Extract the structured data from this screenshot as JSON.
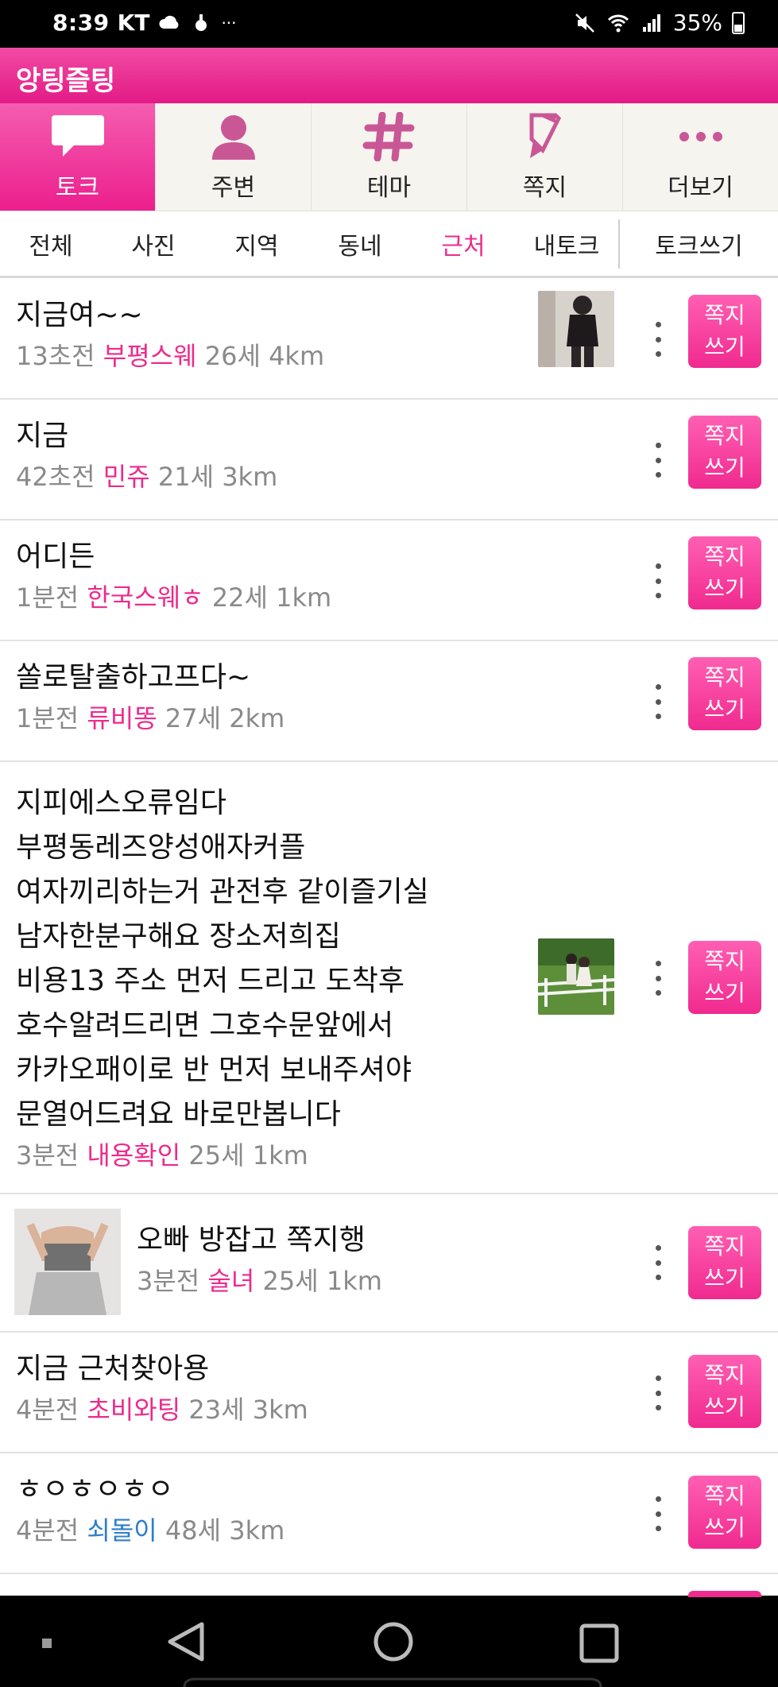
{
  "status_bar": {
    "time": "8:39",
    "carrier": "KT",
    "battery": "35%"
  },
  "app": {
    "title": "앙팅즐팅"
  },
  "main_tabs": [
    {
      "label": "토크",
      "icon": "chat-bubble-icon",
      "active": true
    },
    {
      "label": "주변",
      "icon": "person-icon",
      "active": false
    },
    {
      "label": "테마",
      "icon": "hashtag-icon",
      "active": false
    },
    {
      "label": "쪽지",
      "icon": "note-icon",
      "active": false
    },
    {
      "label": "더보기",
      "icon": "more-dots-icon",
      "active": false
    }
  ],
  "sub_tabs": [
    "전체",
    "사진",
    "지역",
    "동네",
    "근처",
    "내토크"
  ],
  "sub_tabs_active": "근처",
  "write_talk_label": "토크쓰기",
  "feed": [
    {
      "title": "지금여~~",
      "time": "13초전",
      "nick": "부평스웨",
      "age": "26세",
      "dist": "4km",
      "button": "쪽지\n쓰기"
    },
    {
      "title": "지금",
      "time": "42초전",
      "nick": "민쥬",
      "age": "21세",
      "dist": "3km",
      "button": "쪽지\n쓰기"
    },
    {
      "title": "어디든",
      "time": "1분전",
      "nick": "한국스웨ㅎ",
      "age": "22세",
      "dist": "1km",
      "button": "쪽지\n쓰기"
    },
    {
      "title": "쏠로탈출하고프다~",
      "time": "1분전",
      "nick": "류비똥",
      "age": "27세",
      "dist": "2km",
      "button": "쪽지\n쓰기"
    },
    {
      "title_lines": [
        "지피에스오류임다",
        "부평동레즈양성애자커플",
        "여자끼리하는거 관전후  같이즐기실",
        "남자한분구해요 장소저희집",
        "비용13 주소 먼저 드리고 도착후",
        "호수알려드리면 그호수문앞에서",
        "카카오패이로 반 먼저 보내주셔야",
        "문열어드려요 바로만봅니다"
      ],
      "time": "3분전",
      "nick": "내용확인",
      "age": "25세",
      "dist": "1km",
      "button": "쪽지\n쓰기"
    },
    {
      "title": "오빠 방잡고 쪽지행",
      "time": "3분전",
      "nick": "술녀",
      "age": "25세",
      "dist": "1km",
      "button": "쪽지\n쓰기"
    },
    {
      "title": "지금 근처찾아용",
      "time": "4분전",
      "nick": "초비와팅",
      "age": "23세",
      "dist": "3km",
      "button": "쪽지\n쓰기"
    },
    {
      "title": "ㅎㅇㅎㅇㅎㅇ",
      "time": "4분전",
      "nick": "쇠돌이",
      "age": "48세",
      "dist": "3km",
      "button": "쪽지\n쓰기"
    }
  ],
  "colors": {
    "accent": "#ec1f8d",
    "male_nick": "#2b7ec9",
    "meta_gray": "#8a8a8a"
  }
}
